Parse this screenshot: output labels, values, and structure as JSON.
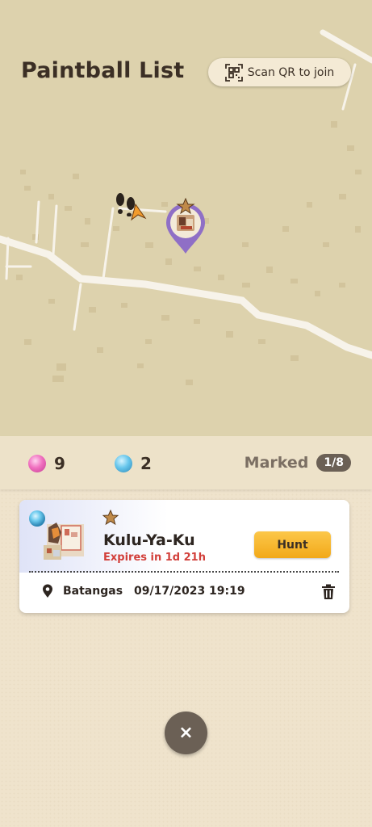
{
  "header": {
    "title": "Paintball List",
    "scan_label": "Scan QR to join"
  },
  "stats": {
    "pink_count": "9",
    "blue_count": "2",
    "marked_label": "Marked",
    "marked_count": "1/8"
  },
  "card": {
    "monster_name": "Kulu-Ya-Ku",
    "expires": "Expires in 1d 21h",
    "hunt_label": "Hunt",
    "location": "Batangas",
    "datetime": "09/17/2023 19:19"
  },
  "close_label": "×",
  "icons": {
    "scan": "qr-scan-icon",
    "pink_gem": "pink-paintball-gem-icon",
    "blue_gem": "blue-paintball-gem-icon",
    "star": "star-icon",
    "location": "location-pin-icon",
    "delete": "trash-icon",
    "close": "close-icon",
    "player": "footprints-icon",
    "marker": "monster-map-marker-icon"
  },
  "colors": {
    "map_bg": "#ddd2ad",
    "panel_bg": "#efe3cc",
    "hunt_button": "#f4b22a",
    "expires_text": "#d23f3a",
    "badge_bg": "#6b6055"
  }
}
